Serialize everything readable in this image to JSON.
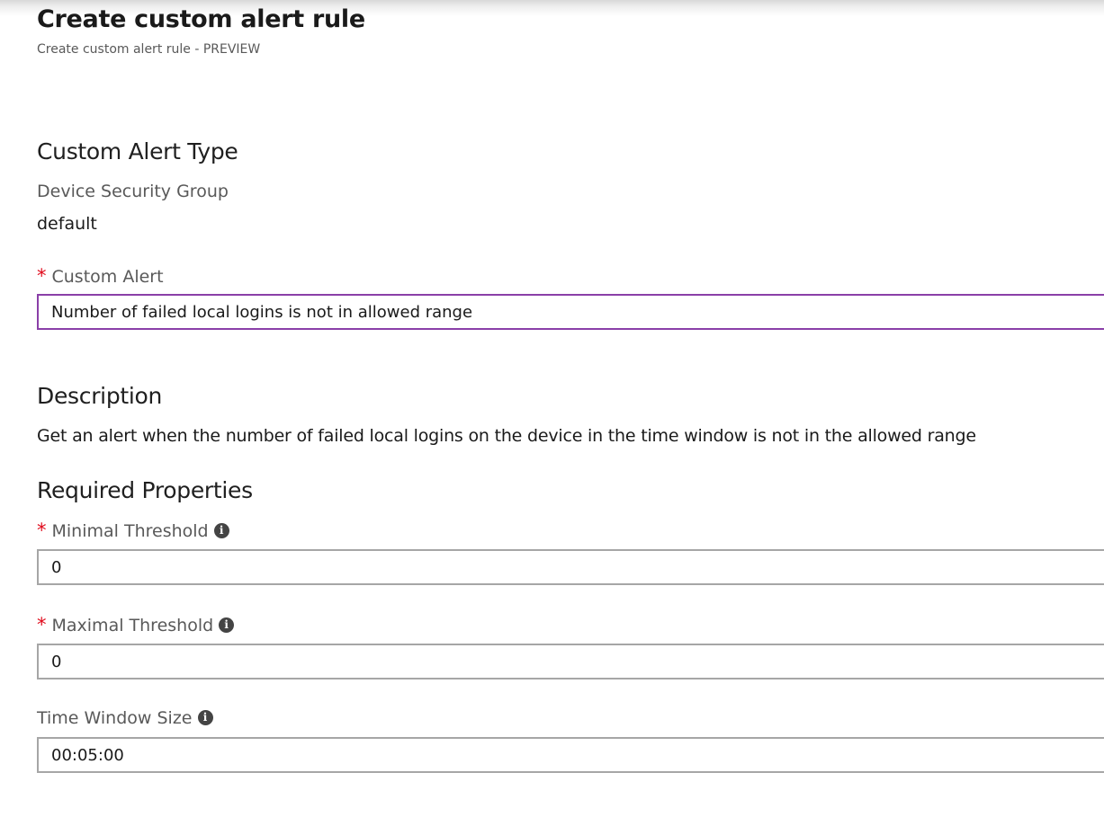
{
  "header": {
    "title": "Create custom alert rule",
    "subtitle": "Create custom alert rule - PREVIEW"
  },
  "custom_alert_type": {
    "heading": "Custom Alert Type",
    "device_security_group_label": "Device Security Group",
    "device_security_group_value": "default"
  },
  "custom_alert": {
    "required_mark": "*",
    "label": "Custom Alert",
    "value": "Number of failed local logins is not in allowed range"
  },
  "description": {
    "heading": "Description",
    "text": "Get an alert when the number of failed local logins on the device in the time window is not in the allowed range"
  },
  "required_properties": {
    "heading": "Required Properties",
    "minimal_threshold": {
      "required_mark": "*",
      "label": "Minimal Threshold",
      "info_icon": "i",
      "value": "0"
    },
    "maximal_threshold": {
      "required_mark": "*",
      "label": "Maximal Threshold",
      "info_icon": "i",
      "value": "0"
    },
    "time_window_size": {
      "label": "Time Window Size",
      "info_icon": "i",
      "value": "00:05:00"
    }
  },
  "colors": {
    "required_asterisk": "#e00b1c",
    "selected_border": "#8a3fa8",
    "input_border": "#a6a6a6",
    "label_gray": "#595959"
  }
}
